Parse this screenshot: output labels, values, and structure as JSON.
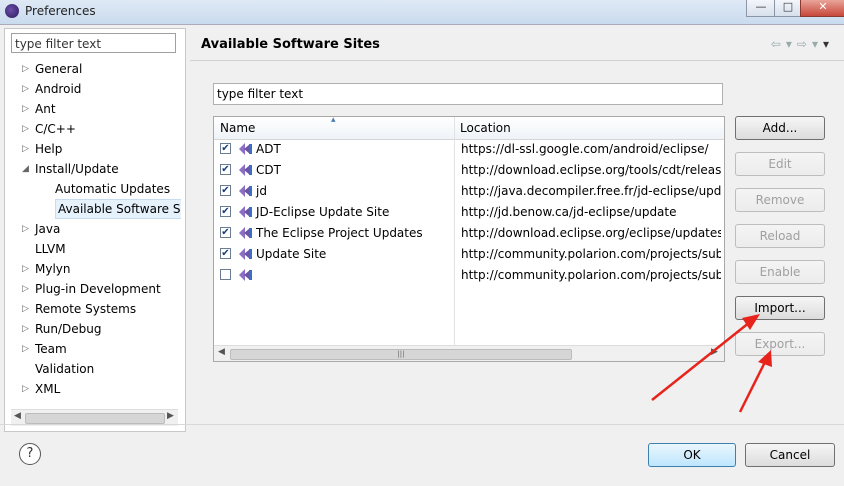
{
  "window": {
    "title": "Preferences",
    "controls": {
      "minimize": "—",
      "maximize": "□",
      "close": "✕"
    }
  },
  "sidebar": {
    "filter_placeholder": "type filter text",
    "items": [
      {
        "label": "General",
        "expandable": true
      },
      {
        "label": "Android",
        "expandable": true
      },
      {
        "label": "Ant",
        "expandable": true
      },
      {
        "label": "C/C++",
        "expandable": true
      },
      {
        "label": "Help",
        "expandable": true
      },
      {
        "label": "Install/Update",
        "expandable": true,
        "expanded": true
      },
      {
        "label": "Automatic Updates",
        "child": true
      },
      {
        "label": "Available Software Sit",
        "child": true,
        "selected": true
      },
      {
        "label": "Java",
        "expandable": true
      },
      {
        "label": "LLVM",
        "expandable": false
      },
      {
        "label": "Mylyn",
        "expandable": true
      },
      {
        "label": "Plug-in Development",
        "expandable": true
      },
      {
        "label": "Remote Systems",
        "expandable": true
      },
      {
        "label": "Run/Debug",
        "expandable": true
      },
      {
        "label": "Team",
        "expandable": true
      },
      {
        "label": "Validation",
        "expandable": false
      },
      {
        "label": "XML",
        "expandable": true
      }
    ]
  },
  "page": {
    "title": "Available Software Sites",
    "filter_placeholder": "type filter text",
    "columns": {
      "name": "Name",
      "location": "Location"
    },
    "sites": [
      {
        "checked": true,
        "name": "ADT",
        "location": "https://dl-ssl.google.com/android/eclipse/"
      },
      {
        "checked": true,
        "name": "CDT",
        "location": "http://download.eclipse.org/tools/cdt/release"
      },
      {
        "checked": true,
        "name": "jd",
        "location": "http://java.decompiler.free.fr/jd-eclipse/upda"
      },
      {
        "checked": true,
        "name": "JD-Eclipse Update Site",
        "location": "http://jd.benow.ca/jd-eclipse/update"
      },
      {
        "checked": true,
        "name": "The Eclipse Project Updates",
        "location": "http://download.eclipse.org/eclipse/updates/"
      },
      {
        "checked": true,
        "name": "Update Site",
        "location": "http://community.polarion.com/projects/subv"
      },
      {
        "checked": false,
        "name": "",
        "location": "http://community.polarion.com/projects/subv"
      }
    ],
    "buttons": {
      "add": "Add...",
      "edit": "Edit",
      "remove": "Remove",
      "reload": "Reload",
      "enable": "Enable",
      "import": "Import...",
      "export": "Export..."
    }
  },
  "footer": {
    "help": "?",
    "ok": "OK",
    "cancel": "Cancel"
  },
  "colors": {
    "accent": "#3c7fb1",
    "annotation_arrow": "#e8231b",
    "selection": "#e5f1fb"
  }
}
